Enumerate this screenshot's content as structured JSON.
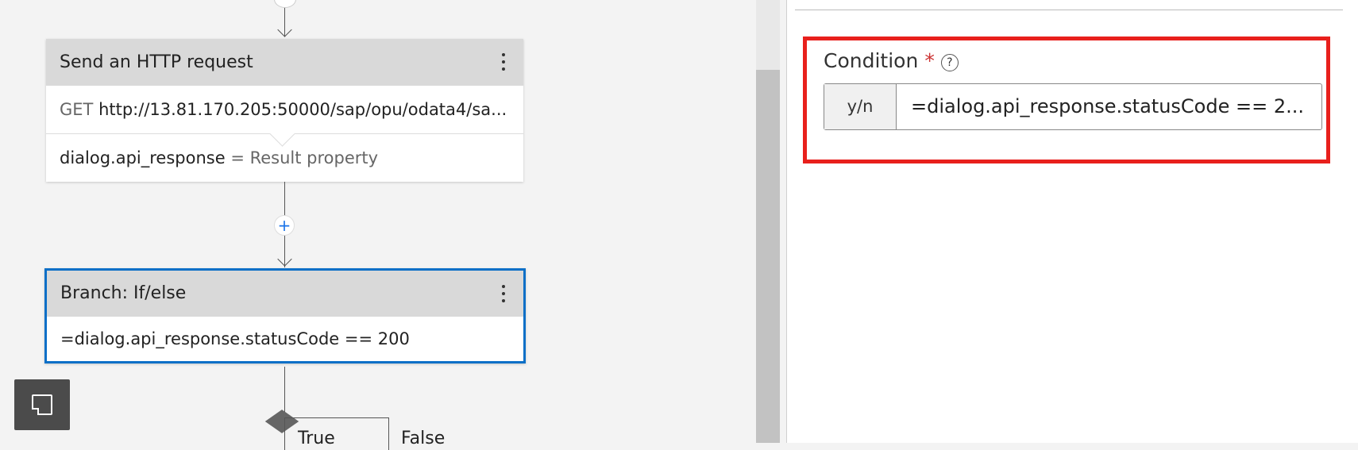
{
  "canvas": {
    "http_card": {
      "title": "Send an HTTP request",
      "method": "GET",
      "url": "http://13.81.170.205:50000/sap/opu/odata4/sa...",
      "result_var": "dialog.api_response",
      "result_sep": " = ",
      "result_label": "Result property"
    },
    "add_button": "+",
    "branch_card": {
      "title": "Branch: If/else",
      "condition": "=dialog.api_response.statusCode == 200"
    },
    "branch_true_label": "True",
    "branch_false_label": "False"
  },
  "panel": {
    "condition_label": "Condition",
    "required_marker": "*",
    "help_icon": "?",
    "type_addon": "y/n",
    "condition_value": "=dialog.api_response.statusCode == 2..."
  },
  "colors": {
    "selected_border": "#0a6fc7",
    "highlight_border": "#e8201c",
    "add_button_accent": "#1a73e8"
  },
  "icons": [
    "kebab-menu-icon",
    "plus-icon",
    "help-circle-icon",
    "sticky-note-icon",
    "decision-diamond-icon"
  ]
}
